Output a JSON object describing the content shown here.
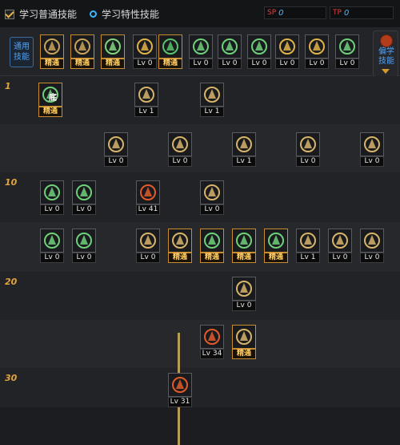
{
  "header": {
    "option_normal": "学习普通技能",
    "option_special": "学习特性技能",
    "sp_label": "SP",
    "sp_value": "0",
    "tp_label": "TP",
    "tp_value": "0"
  },
  "common": {
    "label": "通用技能",
    "skills": [
      {
        "badge": "精通",
        "color": "#c9a35a"
      },
      {
        "badge": "精通",
        "color": "#c9a35a"
      },
      {
        "badge": "精通",
        "color": "#7fd67a"
      },
      {
        "badge": "Lv 0",
        "color": "#e0b24a"
      },
      {
        "badge": "精通",
        "color": "#58c46a"
      },
      {
        "badge": "Lv 0",
        "color": "#6fd07a"
      },
      {
        "badge": "Lv 0",
        "color": "#6fd07a"
      },
      {
        "badge": "Lv 0",
        "color": "#6fd07a"
      },
      {
        "badge": "Lv 0",
        "color": "#e0b24a"
      },
      {
        "badge": "Lv 0",
        "color": "#e0b24a"
      },
      {
        "badge": "Lv 0",
        "color": "#6fd07a"
      }
    ]
  },
  "right_tab": {
    "label": "偏学技能"
  },
  "levels": [
    "1",
    "10",
    "20",
    "30"
  ],
  "tree": [
    {
      "badge": "精通",
      "color": "#6fd07a",
      "glyph": "底"
    },
    {
      "badge": "Lv 1",
      "color": "#d7b46a"
    },
    {
      "badge": "Lv 1",
      "color": "#d7b46a"
    },
    {
      "badge": "Lv 0",
      "color": "#d7b46a"
    },
    {
      "badge": "Lv 0",
      "color": "#d7b46a"
    },
    {
      "badge": "Lv 1",
      "color": "#d7b46a"
    },
    {
      "badge": "Lv 0",
      "color": "#d7b46a"
    },
    {
      "badge": "Lv 0",
      "color": "#d7b46a"
    },
    {
      "badge": "Lv 0",
      "color": "#6fd07a"
    },
    {
      "badge": "Lv 0",
      "color": "#6fd07a"
    },
    {
      "badge": "Lv 41",
      "color": "#e25a2a"
    },
    {
      "badge": "Lv 0",
      "color": "#d7b46a"
    },
    {
      "badge": "Lv 0",
      "color": "#6fd07a"
    },
    {
      "badge": "Lv 0",
      "color": "#6fd07a"
    },
    {
      "badge": "Lv 0",
      "color": "#d7b46a"
    },
    {
      "badge": "精通",
      "color": "#d7b46a"
    },
    {
      "badge": "精通",
      "color": "#6fd07a"
    },
    {
      "badge": "精通",
      "color": "#6fd07a"
    },
    {
      "badge": "精通",
      "color": "#6fd07a"
    },
    {
      "badge": "Lv 1",
      "color": "#d7b46a"
    },
    {
      "badge": "Lv 0",
      "color": "#d7b46a"
    },
    {
      "badge": "Lv 0",
      "color": "#d7b46a"
    },
    {
      "badge": "Lv 0",
      "color": "#d7b46a"
    },
    {
      "badge": "Lv 34",
      "color": "#e25a2a"
    },
    {
      "badge": "精通",
      "color": "#d7b46a"
    },
    {
      "badge": "Lv 31",
      "color": "#e25a2a"
    }
  ]
}
